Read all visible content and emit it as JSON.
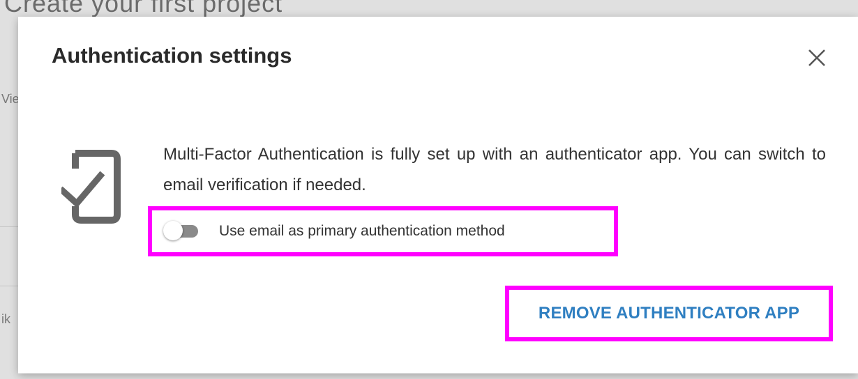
{
  "background": {
    "heading": "Create your first project",
    "fragment_left_top": "Vie",
    "fragment_left_bottom": "ik"
  },
  "dialog": {
    "title": "Authentication settings",
    "close_icon": "close-icon",
    "status_icon": "phone-check-icon",
    "description": "Multi-Factor Authentication is fully set up with an authenticator app. You can switch to email verification if needed.",
    "toggle": {
      "label": "Use email as primary authentication method",
      "checked": false
    },
    "remove_button_label": "REMOVE AUTHENTICATOR APP"
  },
  "colors": {
    "accent": "#2f7fc1",
    "highlight": "#ff00ff",
    "icon": "#666666"
  }
}
